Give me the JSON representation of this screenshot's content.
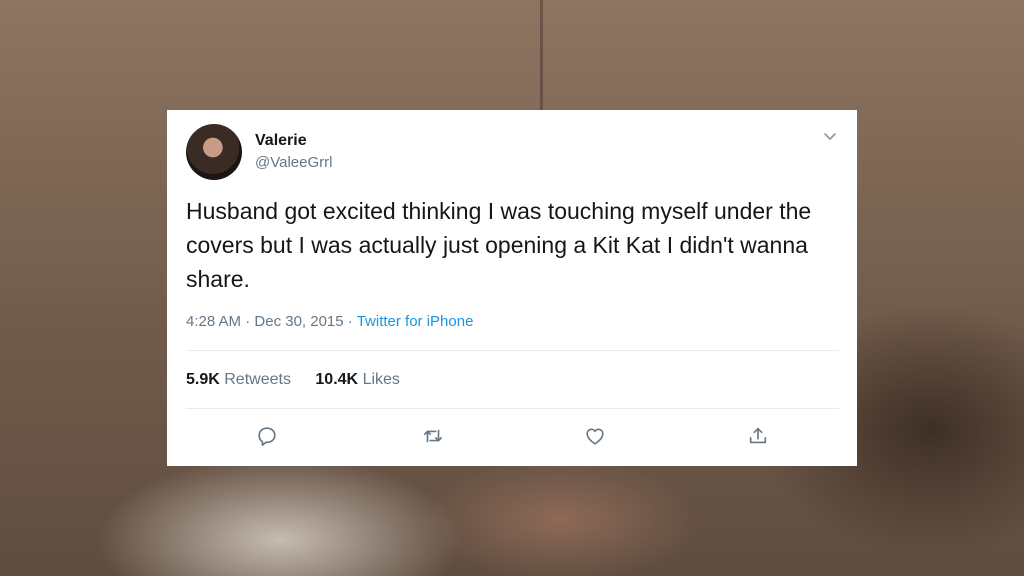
{
  "tweet": {
    "name": "Valerie",
    "handle": "@ValeeGrrl",
    "text": "Husband got excited thinking I was touching myself under the covers but I was actually just opening a Kit Kat I didn't wanna share.",
    "time": "4:28 AM",
    "date": "Dec 30, 2015",
    "separator": "·",
    "source": "Twitter for iPhone",
    "retweets_count": "5.9K",
    "retweets_label": "Retweets",
    "likes_count": "10.4K",
    "likes_label": "Likes"
  },
  "icons": {
    "menu": "chevron-down-icon",
    "reply": "reply-icon",
    "retweet": "retweet-icon",
    "like": "heart-icon",
    "share": "share-icon"
  },
  "colors": {
    "link": "#1b95e0",
    "secondary_text": "#657786",
    "primary_text": "#14171a"
  }
}
